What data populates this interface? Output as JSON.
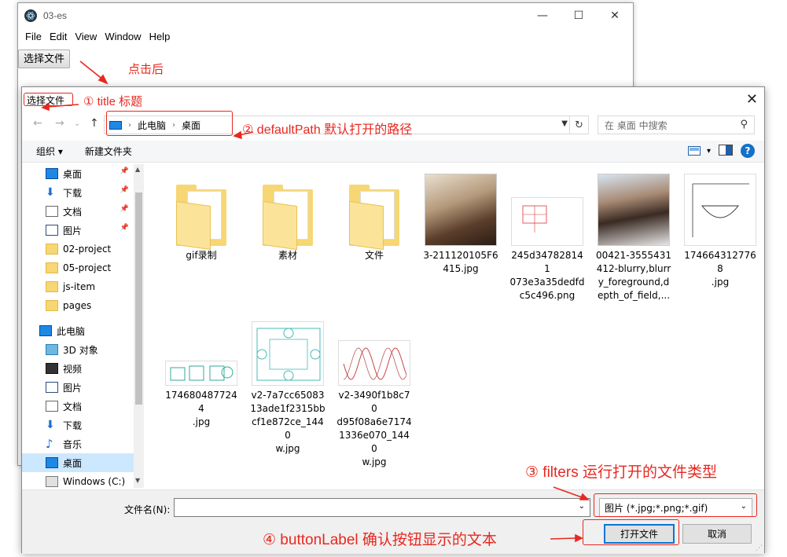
{
  "app_window": {
    "title": "03-es",
    "controls": {
      "minimize": "—",
      "maximize": "☐",
      "close": "✕"
    },
    "menu": [
      "File",
      "Edit",
      "View",
      "Window",
      "Help"
    ],
    "select_button_label": "选择文件",
    "icon": "electron-icon"
  },
  "dialog": {
    "title": "选择文件",
    "close_glyph": "✕",
    "nav": {
      "back": "←",
      "forward": "→",
      "recent": "⌄",
      "up": "↑"
    },
    "breadcrumb": [
      "此电脑",
      "桌面"
    ],
    "search_placeholder": "在 桌面 中搜索",
    "toolbar": {
      "organize": "组织 ▾",
      "new_folder": "新建文件夹",
      "help": "?"
    },
    "sidebar": [
      {
        "label": "桌面",
        "icon": "desktop-icon",
        "pinned": true
      },
      {
        "label": "下载",
        "icon": "download-icon",
        "pinned": true
      },
      {
        "label": "文档",
        "icon": "document-icon",
        "pinned": true
      },
      {
        "label": "图片",
        "icon": "picture-icon",
        "pinned": true
      },
      {
        "label": "02-project",
        "icon": "folder-icon",
        "pinned": false
      },
      {
        "label": "05-project",
        "icon": "folder-icon",
        "pinned": false
      },
      {
        "label": "js-item",
        "icon": "folder-icon",
        "pinned": false
      },
      {
        "label": "pages",
        "icon": "folder-icon",
        "pinned": false
      },
      {
        "label": "此电脑",
        "icon": "computer-icon",
        "pinned": false
      },
      {
        "label": "3D 对象",
        "icon": "3d-object-icon",
        "pinned": false
      },
      {
        "label": "视频",
        "icon": "video-icon",
        "pinned": false
      },
      {
        "label": "图片",
        "icon": "picture-icon",
        "pinned": false
      },
      {
        "label": "文档",
        "icon": "document-icon",
        "pinned": false
      },
      {
        "label": "下载",
        "icon": "download-icon",
        "pinned": false
      },
      {
        "label": "音乐",
        "icon": "music-icon",
        "pinned": false
      },
      {
        "label": "桌面",
        "icon": "desktop-icon",
        "pinned": false,
        "selected": true
      },
      {
        "label": "Windows (C:)",
        "icon": "drive-icon",
        "pinned": false
      }
    ],
    "files": [
      {
        "name1": "gif录制",
        "name2": "",
        "name3": "",
        "name4": "",
        "kind": "folder"
      },
      {
        "name1": "素材",
        "name2": "",
        "name3": "",
        "name4": "",
        "kind": "folder"
      },
      {
        "name1": "文件",
        "name2": "",
        "name3": "",
        "name4": "",
        "kind": "folder"
      },
      {
        "name1": "3-211120105F6",
        "name2": "415.jpg",
        "name3": "",
        "name4": "",
        "kind": "photo"
      },
      {
        "name1": "245d347828141",
        "name2": "073e3a35dedfd",
        "name3": "c5c496.png",
        "name4": "",
        "kind": "sketch"
      },
      {
        "name1": "00421-3555431",
        "name2": "412-blurry,blurr",
        "name3": "y_foreground,d",
        "name4": "epth_of_field,...",
        "kind": "photo"
      },
      {
        "name1": "1746643127768",
        "name2": ".jpg",
        "name3": "",
        "name4": "",
        "kind": "sketch"
      },
      {
        "name1": "1746804877244",
        "name2": ".jpg",
        "name3": "",
        "name4": "",
        "kind": "sketch"
      },
      {
        "name1": "v2-7a7cc65083",
        "name2": "13ade1f2315bb",
        "name3": "cf1e872ce_1440",
        "name4": "w.jpg",
        "kind": "sketch"
      },
      {
        "name1": "v2-3490f1b8c70",
        "name2": "d95f08a6e7174",
        "name3": "1336e070_1440",
        "name4": "w.jpg",
        "kind": "sketch"
      }
    ],
    "filename_label": "文件名(N):",
    "filename_value": "",
    "filter_value": "图片 (*.jpg;*.png;*.gif)",
    "open_button": "打开文件",
    "cancel_button": "取消"
  },
  "annotations": {
    "after_click": "点击后",
    "title": "① title 标题",
    "default_path": "② defaultPath 默认打开的路径",
    "filters": "③ filters 运行打开的文件类型",
    "button_label": "④ buttonLabel 确认按钮显示的文本",
    "color": "#e8281f"
  }
}
